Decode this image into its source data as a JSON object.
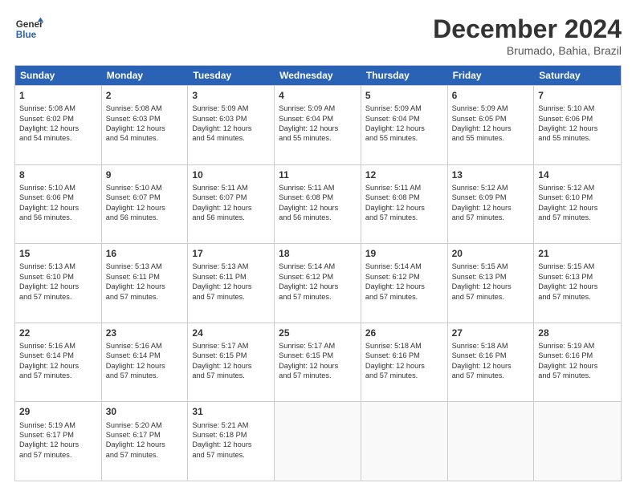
{
  "header": {
    "logo_line1": "General",
    "logo_line2": "Blue",
    "month": "December 2024",
    "location": "Brumado, Bahia, Brazil"
  },
  "weekdays": [
    "Sunday",
    "Monday",
    "Tuesday",
    "Wednesday",
    "Thursday",
    "Friday",
    "Saturday"
  ],
  "rows": [
    [
      {
        "day": "1",
        "lines": [
          "Sunrise: 5:08 AM",
          "Sunset: 6:02 PM",
          "Daylight: 12 hours",
          "and 54 minutes."
        ]
      },
      {
        "day": "2",
        "lines": [
          "Sunrise: 5:08 AM",
          "Sunset: 6:03 PM",
          "Daylight: 12 hours",
          "and 54 minutes."
        ]
      },
      {
        "day": "3",
        "lines": [
          "Sunrise: 5:09 AM",
          "Sunset: 6:03 PM",
          "Daylight: 12 hours",
          "and 54 minutes."
        ]
      },
      {
        "day": "4",
        "lines": [
          "Sunrise: 5:09 AM",
          "Sunset: 6:04 PM",
          "Daylight: 12 hours",
          "and 55 minutes."
        ]
      },
      {
        "day": "5",
        "lines": [
          "Sunrise: 5:09 AM",
          "Sunset: 6:04 PM",
          "Daylight: 12 hours",
          "and 55 minutes."
        ]
      },
      {
        "day": "6",
        "lines": [
          "Sunrise: 5:09 AM",
          "Sunset: 6:05 PM",
          "Daylight: 12 hours",
          "and 55 minutes."
        ]
      },
      {
        "day": "7",
        "lines": [
          "Sunrise: 5:10 AM",
          "Sunset: 6:06 PM",
          "Daylight: 12 hours",
          "and 55 minutes."
        ]
      }
    ],
    [
      {
        "day": "8",
        "lines": [
          "Sunrise: 5:10 AM",
          "Sunset: 6:06 PM",
          "Daylight: 12 hours",
          "and 56 minutes."
        ]
      },
      {
        "day": "9",
        "lines": [
          "Sunrise: 5:10 AM",
          "Sunset: 6:07 PM",
          "Daylight: 12 hours",
          "and 56 minutes."
        ]
      },
      {
        "day": "10",
        "lines": [
          "Sunrise: 5:11 AM",
          "Sunset: 6:07 PM",
          "Daylight: 12 hours",
          "and 56 minutes."
        ]
      },
      {
        "day": "11",
        "lines": [
          "Sunrise: 5:11 AM",
          "Sunset: 6:08 PM",
          "Daylight: 12 hours",
          "and 56 minutes."
        ]
      },
      {
        "day": "12",
        "lines": [
          "Sunrise: 5:11 AM",
          "Sunset: 6:08 PM",
          "Daylight: 12 hours",
          "and 57 minutes."
        ]
      },
      {
        "day": "13",
        "lines": [
          "Sunrise: 5:12 AM",
          "Sunset: 6:09 PM",
          "Daylight: 12 hours",
          "and 57 minutes."
        ]
      },
      {
        "day": "14",
        "lines": [
          "Sunrise: 5:12 AM",
          "Sunset: 6:10 PM",
          "Daylight: 12 hours",
          "and 57 minutes."
        ]
      }
    ],
    [
      {
        "day": "15",
        "lines": [
          "Sunrise: 5:13 AM",
          "Sunset: 6:10 PM",
          "Daylight: 12 hours",
          "and 57 minutes."
        ]
      },
      {
        "day": "16",
        "lines": [
          "Sunrise: 5:13 AM",
          "Sunset: 6:11 PM",
          "Daylight: 12 hours",
          "and 57 minutes."
        ]
      },
      {
        "day": "17",
        "lines": [
          "Sunrise: 5:13 AM",
          "Sunset: 6:11 PM",
          "Daylight: 12 hours",
          "and 57 minutes."
        ]
      },
      {
        "day": "18",
        "lines": [
          "Sunrise: 5:14 AM",
          "Sunset: 6:12 PM",
          "Daylight: 12 hours",
          "and 57 minutes."
        ]
      },
      {
        "day": "19",
        "lines": [
          "Sunrise: 5:14 AM",
          "Sunset: 6:12 PM",
          "Daylight: 12 hours",
          "and 57 minutes."
        ]
      },
      {
        "day": "20",
        "lines": [
          "Sunrise: 5:15 AM",
          "Sunset: 6:13 PM",
          "Daylight: 12 hours",
          "and 57 minutes."
        ]
      },
      {
        "day": "21",
        "lines": [
          "Sunrise: 5:15 AM",
          "Sunset: 6:13 PM",
          "Daylight: 12 hours",
          "and 57 minutes."
        ]
      }
    ],
    [
      {
        "day": "22",
        "lines": [
          "Sunrise: 5:16 AM",
          "Sunset: 6:14 PM",
          "Daylight: 12 hours",
          "and 57 minutes."
        ]
      },
      {
        "day": "23",
        "lines": [
          "Sunrise: 5:16 AM",
          "Sunset: 6:14 PM",
          "Daylight: 12 hours",
          "and 57 minutes."
        ]
      },
      {
        "day": "24",
        "lines": [
          "Sunrise: 5:17 AM",
          "Sunset: 6:15 PM",
          "Daylight: 12 hours",
          "and 57 minutes."
        ]
      },
      {
        "day": "25",
        "lines": [
          "Sunrise: 5:17 AM",
          "Sunset: 6:15 PM",
          "Daylight: 12 hours",
          "and 57 minutes."
        ]
      },
      {
        "day": "26",
        "lines": [
          "Sunrise: 5:18 AM",
          "Sunset: 6:16 PM",
          "Daylight: 12 hours",
          "and 57 minutes."
        ]
      },
      {
        "day": "27",
        "lines": [
          "Sunrise: 5:18 AM",
          "Sunset: 6:16 PM",
          "Daylight: 12 hours",
          "and 57 minutes."
        ]
      },
      {
        "day": "28",
        "lines": [
          "Sunrise: 5:19 AM",
          "Sunset: 6:16 PM",
          "Daylight: 12 hours",
          "and 57 minutes."
        ]
      }
    ],
    [
      {
        "day": "29",
        "lines": [
          "Sunrise: 5:19 AM",
          "Sunset: 6:17 PM",
          "Daylight: 12 hours",
          "and 57 minutes."
        ]
      },
      {
        "day": "30",
        "lines": [
          "Sunrise: 5:20 AM",
          "Sunset: 6:17 PM",
          "Daylight: 12 hours",
          "and 57 minutes."
        ]
      },
      {
        "day": "31",
        "lines": [
          "Sunrise: 5:21 AM",
          "Sunset: 6:18 PM",
          "Daylight: 12 hours",
          "and 57 minutes."
        ]
      },
      {
        "day": "",
        "lines": []
      },
      {
        "day": "",
        "lines": []
      },
      {
        "day": "",
        "lines": []
      },
      {
        "day": "",
        "lines": []
      }
    ]
  ]
}
